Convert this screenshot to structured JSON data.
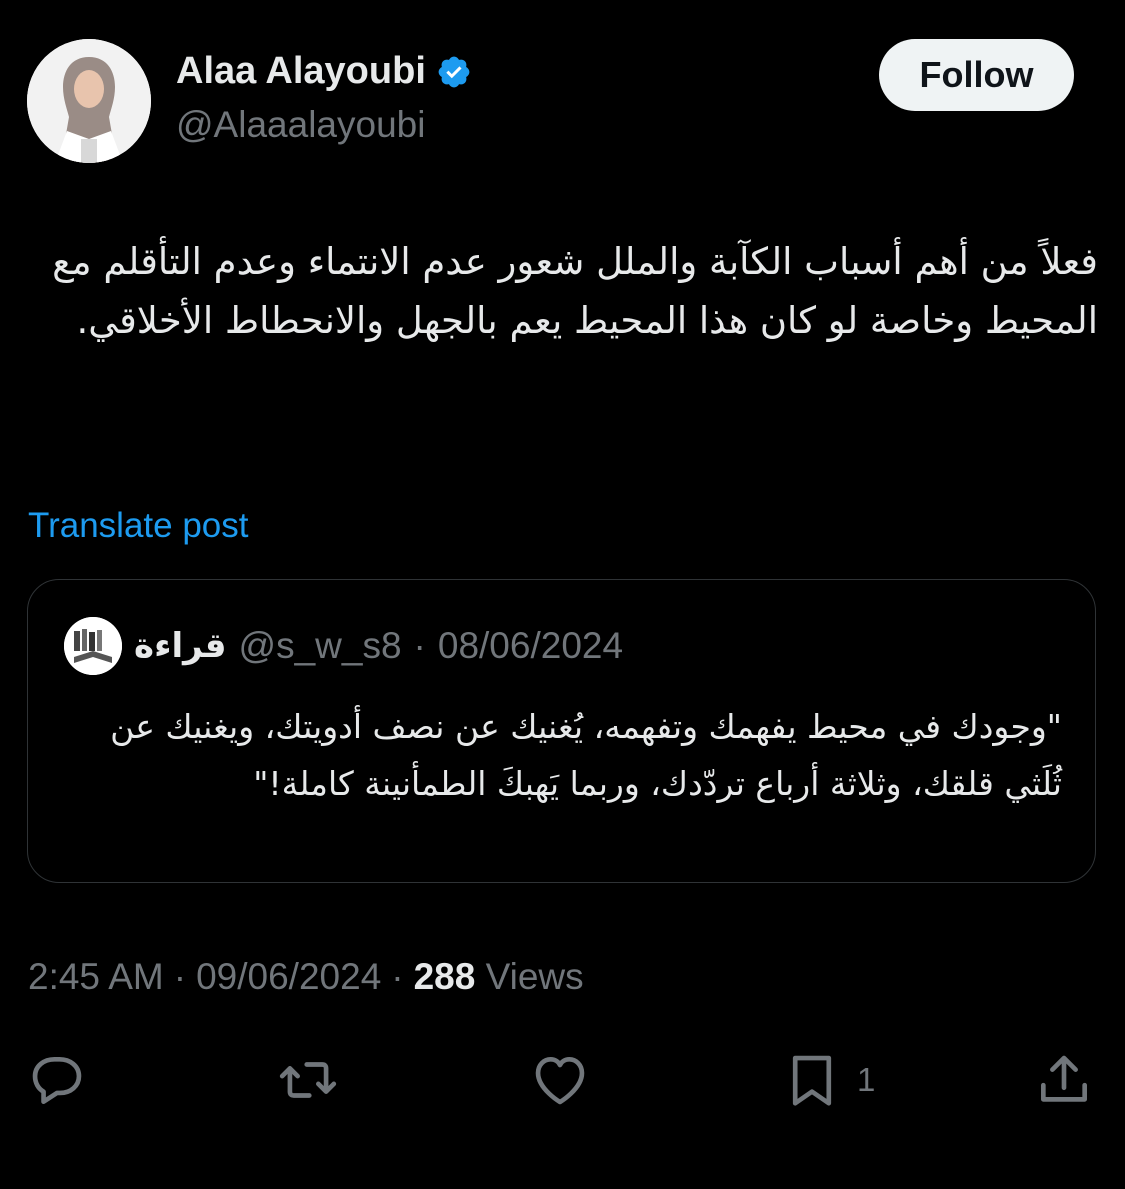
{
  "author": {
    "display_name": "Alaa Alayoubi",
    "handle": "@Alaaalayoubi",
    "verified": true,
    "avatar_icon": "profile-photo"
  },
  "follow_label": "Follow",
  "post": {
    "text": "فعلاً من أهم أسباب الكآبة والملل شعور عدم الانتماء وعدم التأقلم مع المحيط وخاصة لو كان هذا المحيط يعم بالجهل والانحطاط الأخلاقي.",
    "translate_label": "Translate post"
  },
  "quoted_post": {
    "name": "قراءة",
    "handle": "@s_w_s8",
    "separator": "·",
    "date": "08/06/2024",
    "text": "\"وجودك في محيط يفهمك وتفهمه، يُغنيك عن نصف أدويتك، ويغنيك عن ثُلَثي قلقك، وثلاثة أرباع تردّدك، وربما يَهبكَ الطمأنينة كاملة!\""
  },
  "meta": {
    "time": "2:45 AM",
    "separator": "·",
    "date": "09/06/2024",
    "views_count": "288",
    "views_label": "Views"
  },
  "actions": {
    "reply_count": "",
    "repost_count": "",
    "like_count": "",
    "bookmark_count": "1"
  },
  "colors": {
    "background": "#000000",
    "text": "#e7e9ea",
    "muted": "#71767b",
    "link": "#1d9bf0",
    "verified": "#1d9bf0",
    "border": "#2f3336"
  }
}
